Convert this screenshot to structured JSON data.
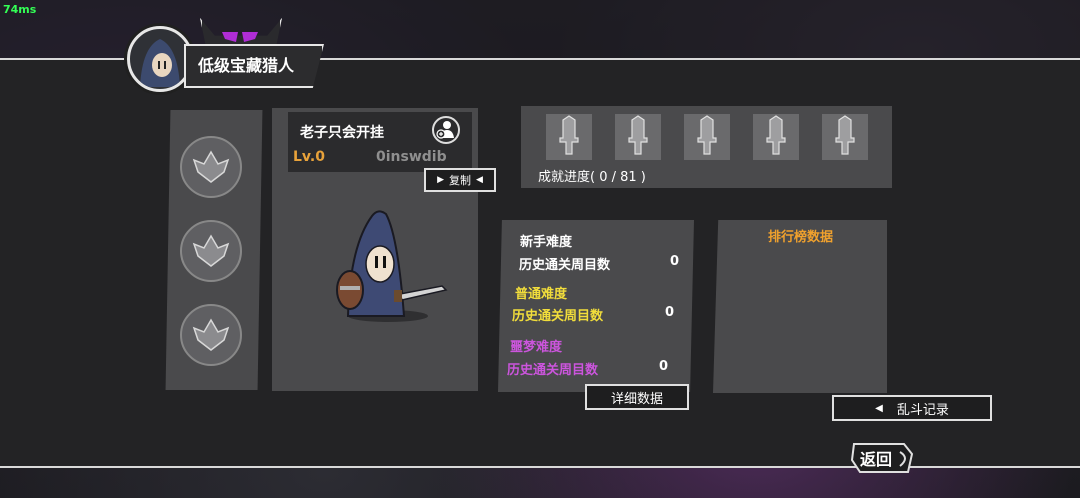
{
  "debug": {
    "frame_time": "74ms"
  },
  "header": {
    "title": "低级宝藏猎人"
  },
  "player": {
    "name": "老子只会开挂",
    "level": "Lv.0",
    "id": "0inswdib",
    "copy_label": "复制"
  },
  "achievements": {
    "slots": 5,
    "progress_label": "成就进度( 0 / 81 )"
  },
  "difficulties": [
    {
      "name": "新手难度",
      "stat_label": "历史通关周目数",
      "value": "0",
      "color": "#ffffff"
    },
    {
      "name": "普通难度",
      "stat_label": "历史通关周目数",
      "value": "0",
      "color": "#f1dd3b"
    },
    {
      "name": "噩梦难度",
      "stat_label": "历史通关周目数",
      "value": "0",
      "color": "#cc55dd"
    }
  ],
  "buttons": {
    "details": "详细数据",
    "brawl_record": "乱斗记录",
    "back": "返回"
  },
  "ranking": {
    "title": "排行榜数据"
  },
  "icons": {
    "left_slots": [
      "lotus-emblem-icon",
      "lotus-emblem-icon",
      "lotus-emblem-icon"
    ],
    "achievement": "sword-hilt-icon"
  }
}
